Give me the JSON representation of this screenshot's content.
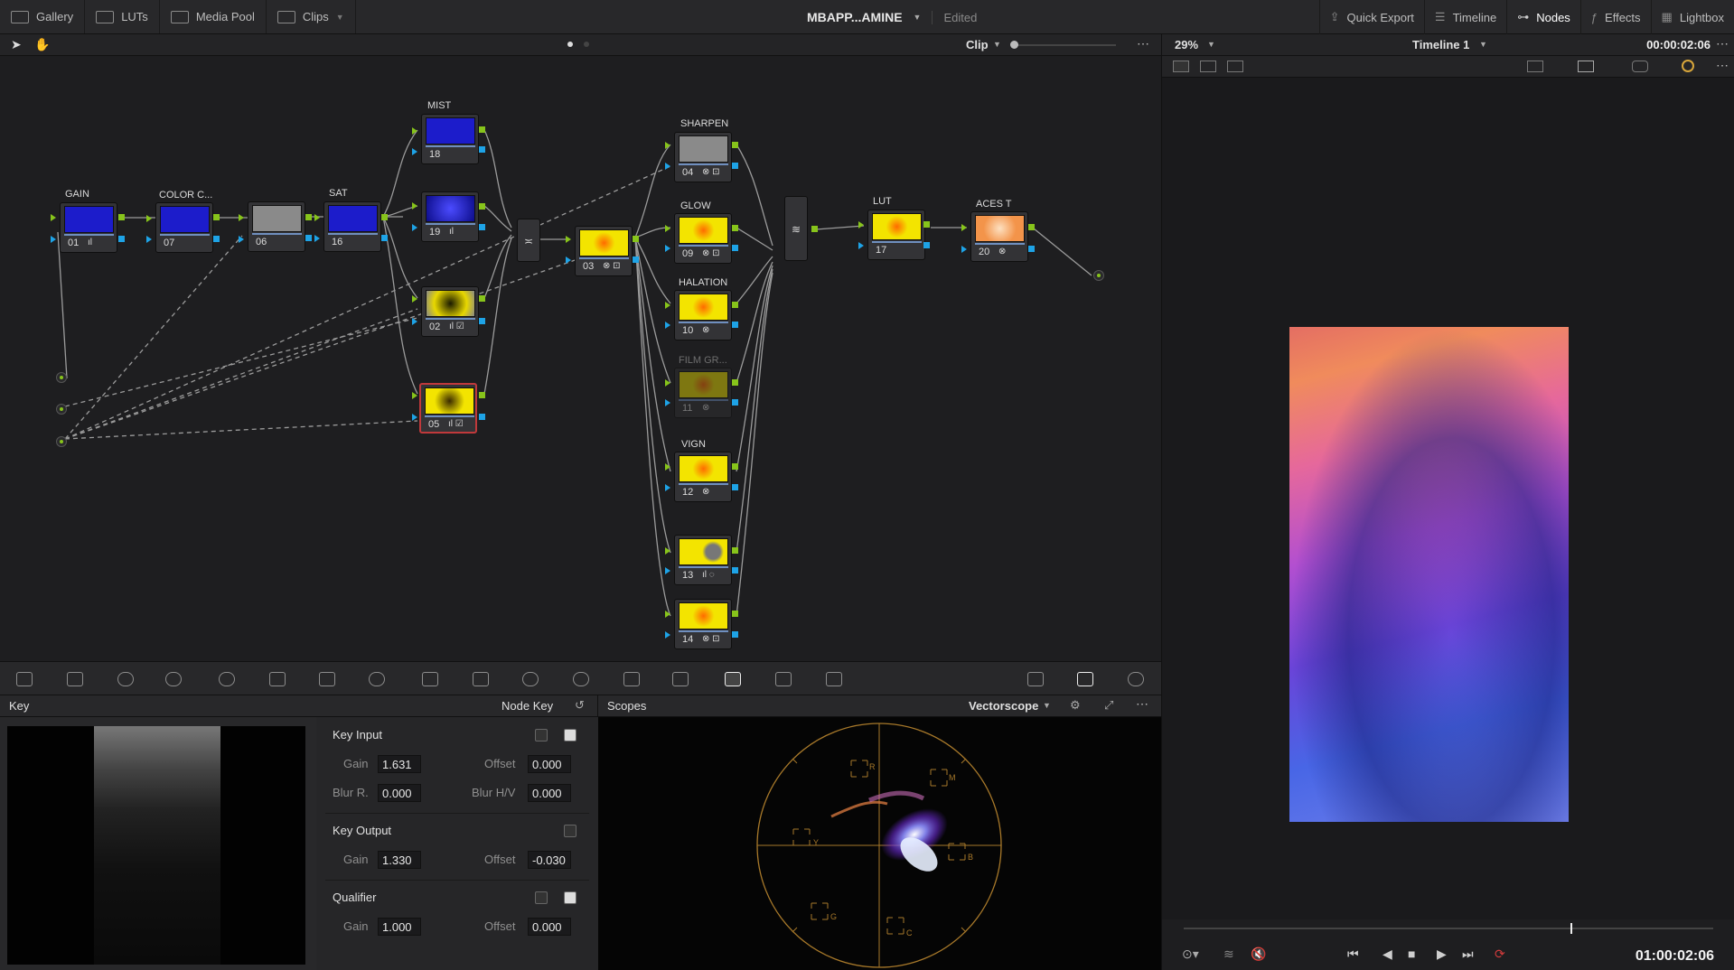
{
  "topbar": {
    "left": [
      {
        "label": "Gallery",
        "icon": "gallery-icon"
      },
      {
        "label": "LUTs",
        "icon": "luts-icon"
      },
      {
        "label": "Media Pool",
        "icon": "media-pool-icon"
      },
      {
        "label": "Clips",
        "icon": "clips-icon"
      }
    ],
    "project_title": "MBAPP...AMINE",
    "edited": "Edited",
    "right": [
      {
        "label": "Quick Export",
        "icon": "export-icon"
      },
      {
        "label": "Timeline",
        "icon": "timeline-icon"
      },
      {
        "label": "Nodes",
        "icon": "nodes-icon"
      },
      {
        "label": "Effects",
        "icon": "fx-icon"
      },
      {
        "label": "Lightbox",
        "icon": "lightbox-icon"
      }
    ]
  },
  "nodebar": {
    "mode": "Clip"
  },
  "viewerbar": {
    "zoom": "29%",
    "timeline": "Timeline 1",
    "timecode": "00:00:02:06"
  },
  "nodes": {
    "n01": {
      "label": "GAIN",
      "num": "01"
    },
    "n07": {
      "label": "COLOR C...",
      "num": "07"
    },
    "n06": {
      "label": "",
      "num": "06"
    },
    "n16": {
      "label": "SAT",
      "num": "16"
    },
    "n18": {
      "label": "MIST",
      "num": "18"
    },
    "n19": {
      "label": "",
      "num": "19"
    },
    "n02": {
      "label": "",
      "num": "02"
    },
    "n05": {
      "label": "",
      "num": "05"
    },
    "n03": {
      "label": "",
      "num": "03"
    },
    "n04": {
      "label": "SHARPEN",
      "num": "04"
    },
    "n09": {
      "label": "GLOW",
      "num": "09"
    },
    "n10": {
      "label": "HALATION",
      "num": "10"
    },
    "n11": {
      "label": "FILM GR...",
      "num": "11"
    },
    "n12": {
      "label": "VIGN",
      "num": "12"
    },
    "n13": {
      "label": "",
      "num": "13"
    },
    "n14": {
      "label": "",
      "num": "14"
    },
    "n17": {
      "label": "LUT",
      "num": "17"
    },
    "n20": {
      "label": "ACES T",
      "num": "20"
    }
  },
  "key": {
    "title": "Key",
    "mode": "Node Key",
    "key_input": {
      "label": "Key Input",
      "gain_label": "Gain",
      "gain": "1.631",
      "offset_label": "Offset",
      "offset": "0.000",
      "blur_r_label": "Blur R.",
      "blur_r": "0.000",
      "blur_hv_label": "Blur H/V",
      "blur_hv": "0.000"
    },
    "key_output": {
      "label": "Key Output",
      "gain_label": "Gain",
      "gain": "1.330",
      "offset_label": "Offset",
      "offset": "-0.030"
    },
    "qualifier": {
      "label": "Qualifier",
      "gain_label": "Gain",
      "gain": "1.000",
      "offset_label": "Offset",
      "offset": "0.000"
    }
  },
  "scopes": {
    "title": "Scopes",
    "type": "Vectorscope",
    "targets": [
      "R",
      "M",
      "B",
      "C",
      "G",
      "Y"
    ]
  },
  "transport": {
    "timecode": "01:00:02:06"
  },
  "colors": {
    "accent_green": "#87c41b",
    "accent_blue": "#1ea3e6",
    "selected_red": "#c0393b"
  }
}
